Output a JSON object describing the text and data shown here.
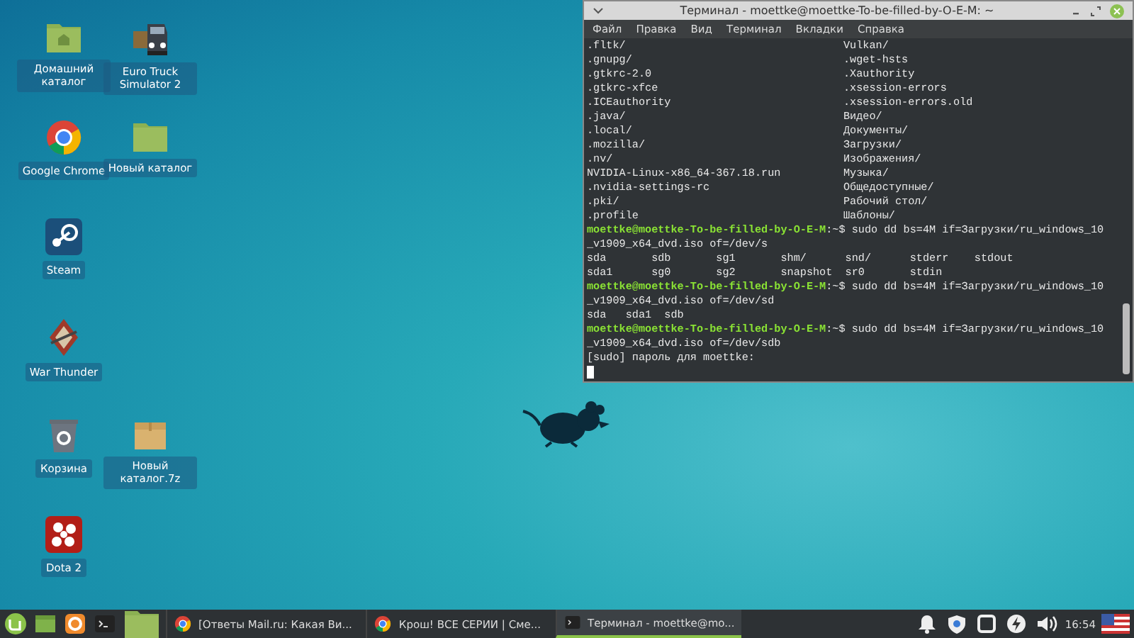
{
  "desktop": {
    "icons": [
      {
        "kind": "home-folder",
        "label": "Домашний каталог"
      },
      {
        "kind": "truck",
        "label": "Euro Truck Simulator 2"
      },
      {
        "kind": "chrome",
        "label": "Google Chrome"
      },
      {
        "kind": "folder",
        "label": "Новый каталог"
      },
      {
        "kind": "steam",
        "label": "Steam"
      },
      {
        "kind": "warthunder",
        "label": "War Thunder"
      },
      {
        "kind": "trash",
        "label": "Корзина"
      },
      {
        "kind": "archive",
        "label": "Новый каталог.7z"
      },
      {
        "kind": "dota",
        "label": "Dota 2"
      }
    ]
  },
  "terminal": {
    "title": "Терминал - moettke@moettke-To-be-filled-by-O-E-M: ~",
    "menu": [
      "Файл",
      "Правка",
      "Вид",
      "Терминал",
      "Вкладки",
      "Справка"
    ],
    "lines": [
      {
        "kind": "columns",
        "left": ".fltk/",
        "right": "Vulkan/"
      },
      {
        "kind": "columns",
        "left": ".gnupg/",
        "right": ".wget-hsts"
      },
      {
        "kind": "columns",
        "left": ".gtkrc-2.0",
        "right": ".Xauthority"
      },
      {
        "kind": "columns",
        "left": ".gtkrc-xfce",
        "right": ".xsession-errors"
      },
      {
        "kind": "columns",
        "left": ".ICEauthority",
        "right": ".xsession-errors.old"
      },
      {
        "kind": "columns",
        "left": ".java/",
        "right": "Видео/"
      },
      {
        "kind": "columns",
        "left": ".local/",
        "right": "Документы/"
      },
      {
        "kind": "columns",
        "left": ".mozilla/",
        "right": "Загрузки/"
      },
      {
        "kind": "columns",
        "left": ".nv/",
        "right": "Изображения/"
      },
      {
        "kind": "columns",
        "left": "NVIDIA-Linux-x86_64-367.18.run",
        "right": "Музыка/"
      },
      {
        "kind": "columns",
        "left": ".nvidia-settings-rc",
        "right": "Общедоступные/"
      },
      {
        "kind": "columns",
        "left": ".pki/",
        "right": "Рабочий стол/"
      },
      {
        "kind": "columns",
        "left": ".profile",
        "right": "Шаблоны/"
      },
      {
        "kind": "prompt",
        "prompt": "moettke@moettke-To-be-filled-by-O-E-M",
        "text": ":~$ sudo dd bs=4M if=Загрузки/ru_windows_10"
      },
      {
        "kind": "output",
        "text": "_v1909_x64_dvd.iso of=/dev/s"
      },
      {
        "kind": "output",
        "text": "sda       sdb       sg1       shm/      snd/      stderr    stdout"
      },
      {
        "kind": "output",
        "text": "sda1      sg0       sg2       snapshot  sr0       stdin"
      },
      {
        "kind": "prompt",
        "prompt": "moettke@moettke-To-be-filled-by-O-E-M",
        "text": ":~$ sudo dd bs=4M if=Загрузки/ru_windows_10"
      },
      {
        "kind": "output",
        "text": "_v1909_x64_dvd.iso of=/dev/sd"
      },
      {
        "kind": "output",
        "text": "sda   sda1  sdb"
      },
      {
        "kind": "prompt",
        "prompt": "moettke@moettke-To-be-filled-by-O-E-M",
        "text": ":~$ sudo dd bs=4M if=Загрузки/ru_windows_10"
      },
      {
        "kind": "output",
        "text": "_v1909_x64_dvd.iso of=/dev/sdb"
      },
      {
        "kind": "output",
        "text": "[sudo] пароль для moettke:"
      }
    ]
  },
  "taskbar": {
    "launchers": [
      {
        "kind": "mint"
      },
      {
        "kind": "files"
      },
      {
        "kind": "firefox"
      },
      {
        "kind": "terminal"
      },
      {
        "kind": "folder"
      }
    ],
    "windows": [
      {
        "kind": "chrome",
        "title": "[Ответы Mail.ru: Какая Ви...",
        "selected": false
      },
      {
        "kind": "chrome",
        "title": "Крош! ВСЕ СЕРИИ | Сме...",
        "selected": false
      },
      {
        "kind": "terminal",
        "title": "Терминал - moettke@mo...",
        "selected": true
      }
    ],
    "tray": [
      {
        "kind": "bell"
      },
      {
        "kind": "shield"
      },
      {
        "kind": "window"
      },
      {
        "kind": "bolt"
      },
      {
        "kind": "speaker"
      }
    ],
    "clock": "16:54"
  }
}
